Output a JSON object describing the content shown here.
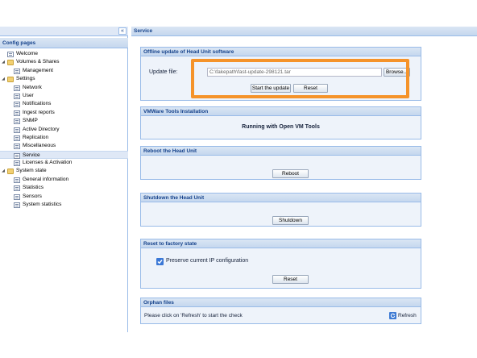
{
  "left_panel": {
    "collapse_glyph": "«",
    "title": "Config pages",
    "tree": [
      {
        "label": "Welcome",
        "icon": "page-icon",
        "level": 1,
        "name": "welcome"
      },
      {
        "label": "Volumes & Shares",
        "icon": "folder-icon",
        "level": 0,
        "expanded": true,
        "name": "volumes-shares"
      },
      {
        "label": "Management",
        "icon": "page-icon",
        "level": 2,
        "name": "management"
      },
      {
        "label": "Settings",
        "icon": "folder-icon",
        "level": 0,
        "expanded": true,
        "name": "settings"
      },
      {
        "label": "Network",
        "icon": "page-icon",
        "level": 2,
        "name": "network"
      },
      {
        "label": "User",
        "icon": "page-icon",
        "level": 2,
        "name": "user"
      },
      {
        "label": "Notifications",
        "icon": "page-icon",
        "level": 2,
        "name": "notifications"
      },
      {
        "label": "Ingest reports",
        "icon": "page-icon",
        "level": 2,
        "name": "ingest-reports"
      },
      {
        "label": "SNMP",
        "icon": "page-icon",
        "level": 2,
        "name": "snmp"
      },
      {
        "label": "Active Directory",
        "icon": "page-icon",
        "level": 2,
        "name": "active-directory"
      },
      {
        "label": "Replication",
        "icon": "page-icon",
        "level": 2,
        "name": "replication"
      },
      {
        "label": "Miscellaneous",
        "icon": "page-icon",
        "level": 2,
        "name": "miscellaneous"
      },
      {
        "label": "Service",
        "icon": "page-icon",
        "level": 2,
        "selected": true,
        "name": "service"
      },
      {
        "label": "Licenses & Activation",
        "icon": "page-icon",
        "level": 2,
        "name": "licenses-activation"
      },
      {
        "label": "System state",
        "icon": "folder-icon",
        "level": 0,
        "expanded": true,
        "name": "system-state"
      },
      {
        "label": "General information",
        "icon": "page-icon",
        "level": 2,
        "name": "general-information"
      },
      {
        "label": "Statistics",
        "icon": "page-icon",
        "level": 2,
        "name": "statistics"
      },
      {
        "label": "Sensors",
        "icon": "page-icon",
        "level": 2,
        "name": "sensors"
      },
      {
        "label": "System statistics",
        "icon": "page-icon",
        "level": 2,
        "name": "system-statistics"
      }
    ]
  },
  "main": {
    "title": "Service",
    "offline_update": {
      "title": "Offline update of Head Unit software",
      "field_label": "Update file:",
      "file_value": "C:\\fakepath\\fast-update-298121.tar",
      "browse_label": "Browse...",
      "start_label": "Start the update",
      "reset_label": "Reset"
    },
    "vmware": {
      "title": "VMWare Tools Installation",
      "status": "Running with Open VM Tools"
    },
    "reboot": {
      "title": "Reboot the Head Unit",
      "button_label": "Reboot"
    },
    "shutdown": {
      "title": "Shutdown the Head Unit",
      "button_label": "Shutdown"
    },
    "factory_reset": {
      "title": "Reset to factory state",
      "checkbox_label": "Preserve current IP configuration",
      "checkbox_checked": true,
      "button_label": "Reset"
    },
    "orphan_files": {
      "title": "Orphan files",
      "message": "Please click on 'Refresh' to start the check",
      "refresh_label": "Refresh"
    }
  },
  "colors": {
    "highlight": "#f5932a",
    "header_text": "#15428b",
    "panel_border": "#99bbe8",
    "checkbox": "#3b78d6"
  }
}
